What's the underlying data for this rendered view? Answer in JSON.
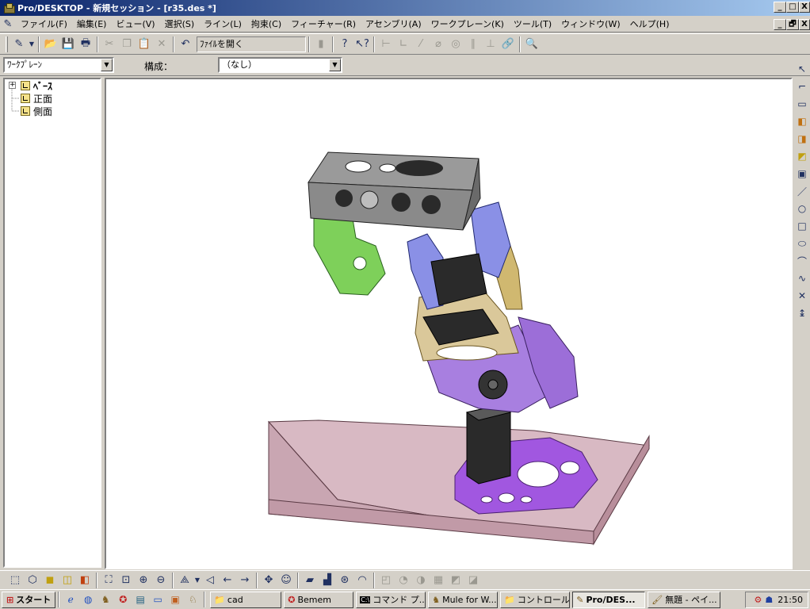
{
  "window": {
    "title": "Pro/DESKTOP - 新規セッション - [r35.des *]",
    "controls": [
      "_",
      "□",
      "X"
    ],
    "doc_controls": [
      "_",
      "🗗",
      "X"
    ]
  },
  "menu": [
    "ファイル(F)",
    "編集(E)",
    "ビュー(V)",
    "選択(S)",
    "ライン(L)",
    "拘束(C)",
    "フィーチャー(R)",
    "アセンブリ(A)",
    "ワークプレーン(K)",
    "ツール(T)",
    "ウィンドウ(W)",
    "ヘルプ(H)"
  ],
  "toolbar": {
    "file_open": "ﾌｧｲﾙを開く"
  },
  "row3": {
    "workplane_select": "ﾜｰｸﾌﾟﾚｰﾝ",
    "config_label": "構成：",
    "config_select": "（なし）"
  },
  "tree": {
    "root": "ﾍﾞｰｽ",
    "children": [
      "正面",
      "側面"
    ]
  },
  "taskbar": {
    "start": "スタート",
    "tasks": [
      "cad",
      "Bemem",
      "コマンド プ...",
      "Mule for W...",
      "コントロール...",
      "Pro/DES...",
      "無題 - ペイ..."
    ],
    "clock": "21:50"
  },
  "colors": {
    "titlebar_start": "#0a246a",
    "titlebar_end": "#a6caf0",
    "face": "#d4d0c8",
    "base_plate": "#d8b9c3",
    "purple_part": "#a87fe0",
    "green_part": "#6ec24a",
    "gold_part": "#d9c48a",
    "gray_part": "#9a9a9a",
    "blue_part": "#8a90e6"
  }
}
